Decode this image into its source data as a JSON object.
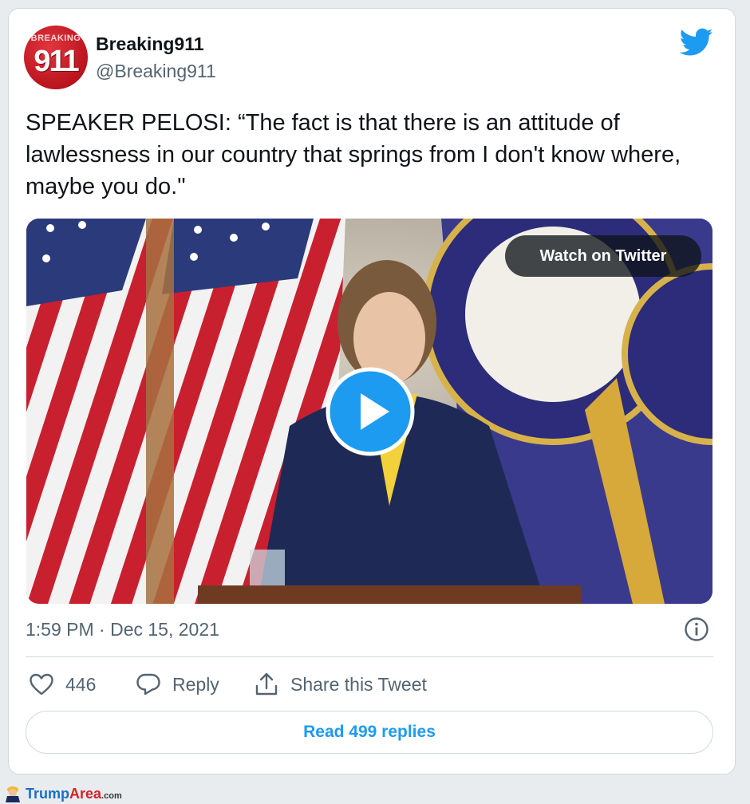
{
  "tweet": {
    "author_name": "Breaking911",
    "author_handle": "@Breaking911",
    "avatar": {
      "top_text": "BREAKING",
      "main_text": "911"
    },
    "text": "SPEAKER PELOSI: “The fact is that there is an attitude of lawlessness in our country that springs from I don't know where, maybe you do.\"",
    "timestamp": "1:59 PM · Dec 15, 2021",
    "icons": [
      "twitter-bird-icon",
      "play-icon",
      "info-icon",
      "heart-icon",
      "reply-icon",
      "share-icon"
    ]
  },
  "media": {
    "watch_label": "Watch on Twitter"
  },
  "actions": {
    "like_count": "446",
    "reply_label": "Reply",
    "share_label": "Share this Tweet"
  },
  "read_replies_label": "Read 499 replies",
  "watermark": {
    "brand_a": "Trump",
    "brand_b": "Area",
    "suffix": ".com"
  },
  "colors": {
    "accent": "#1d9bf0",
    "text": "#0f1419",
    "secondary": "#536471",
    "border": "#cfd9de"
  }
}
